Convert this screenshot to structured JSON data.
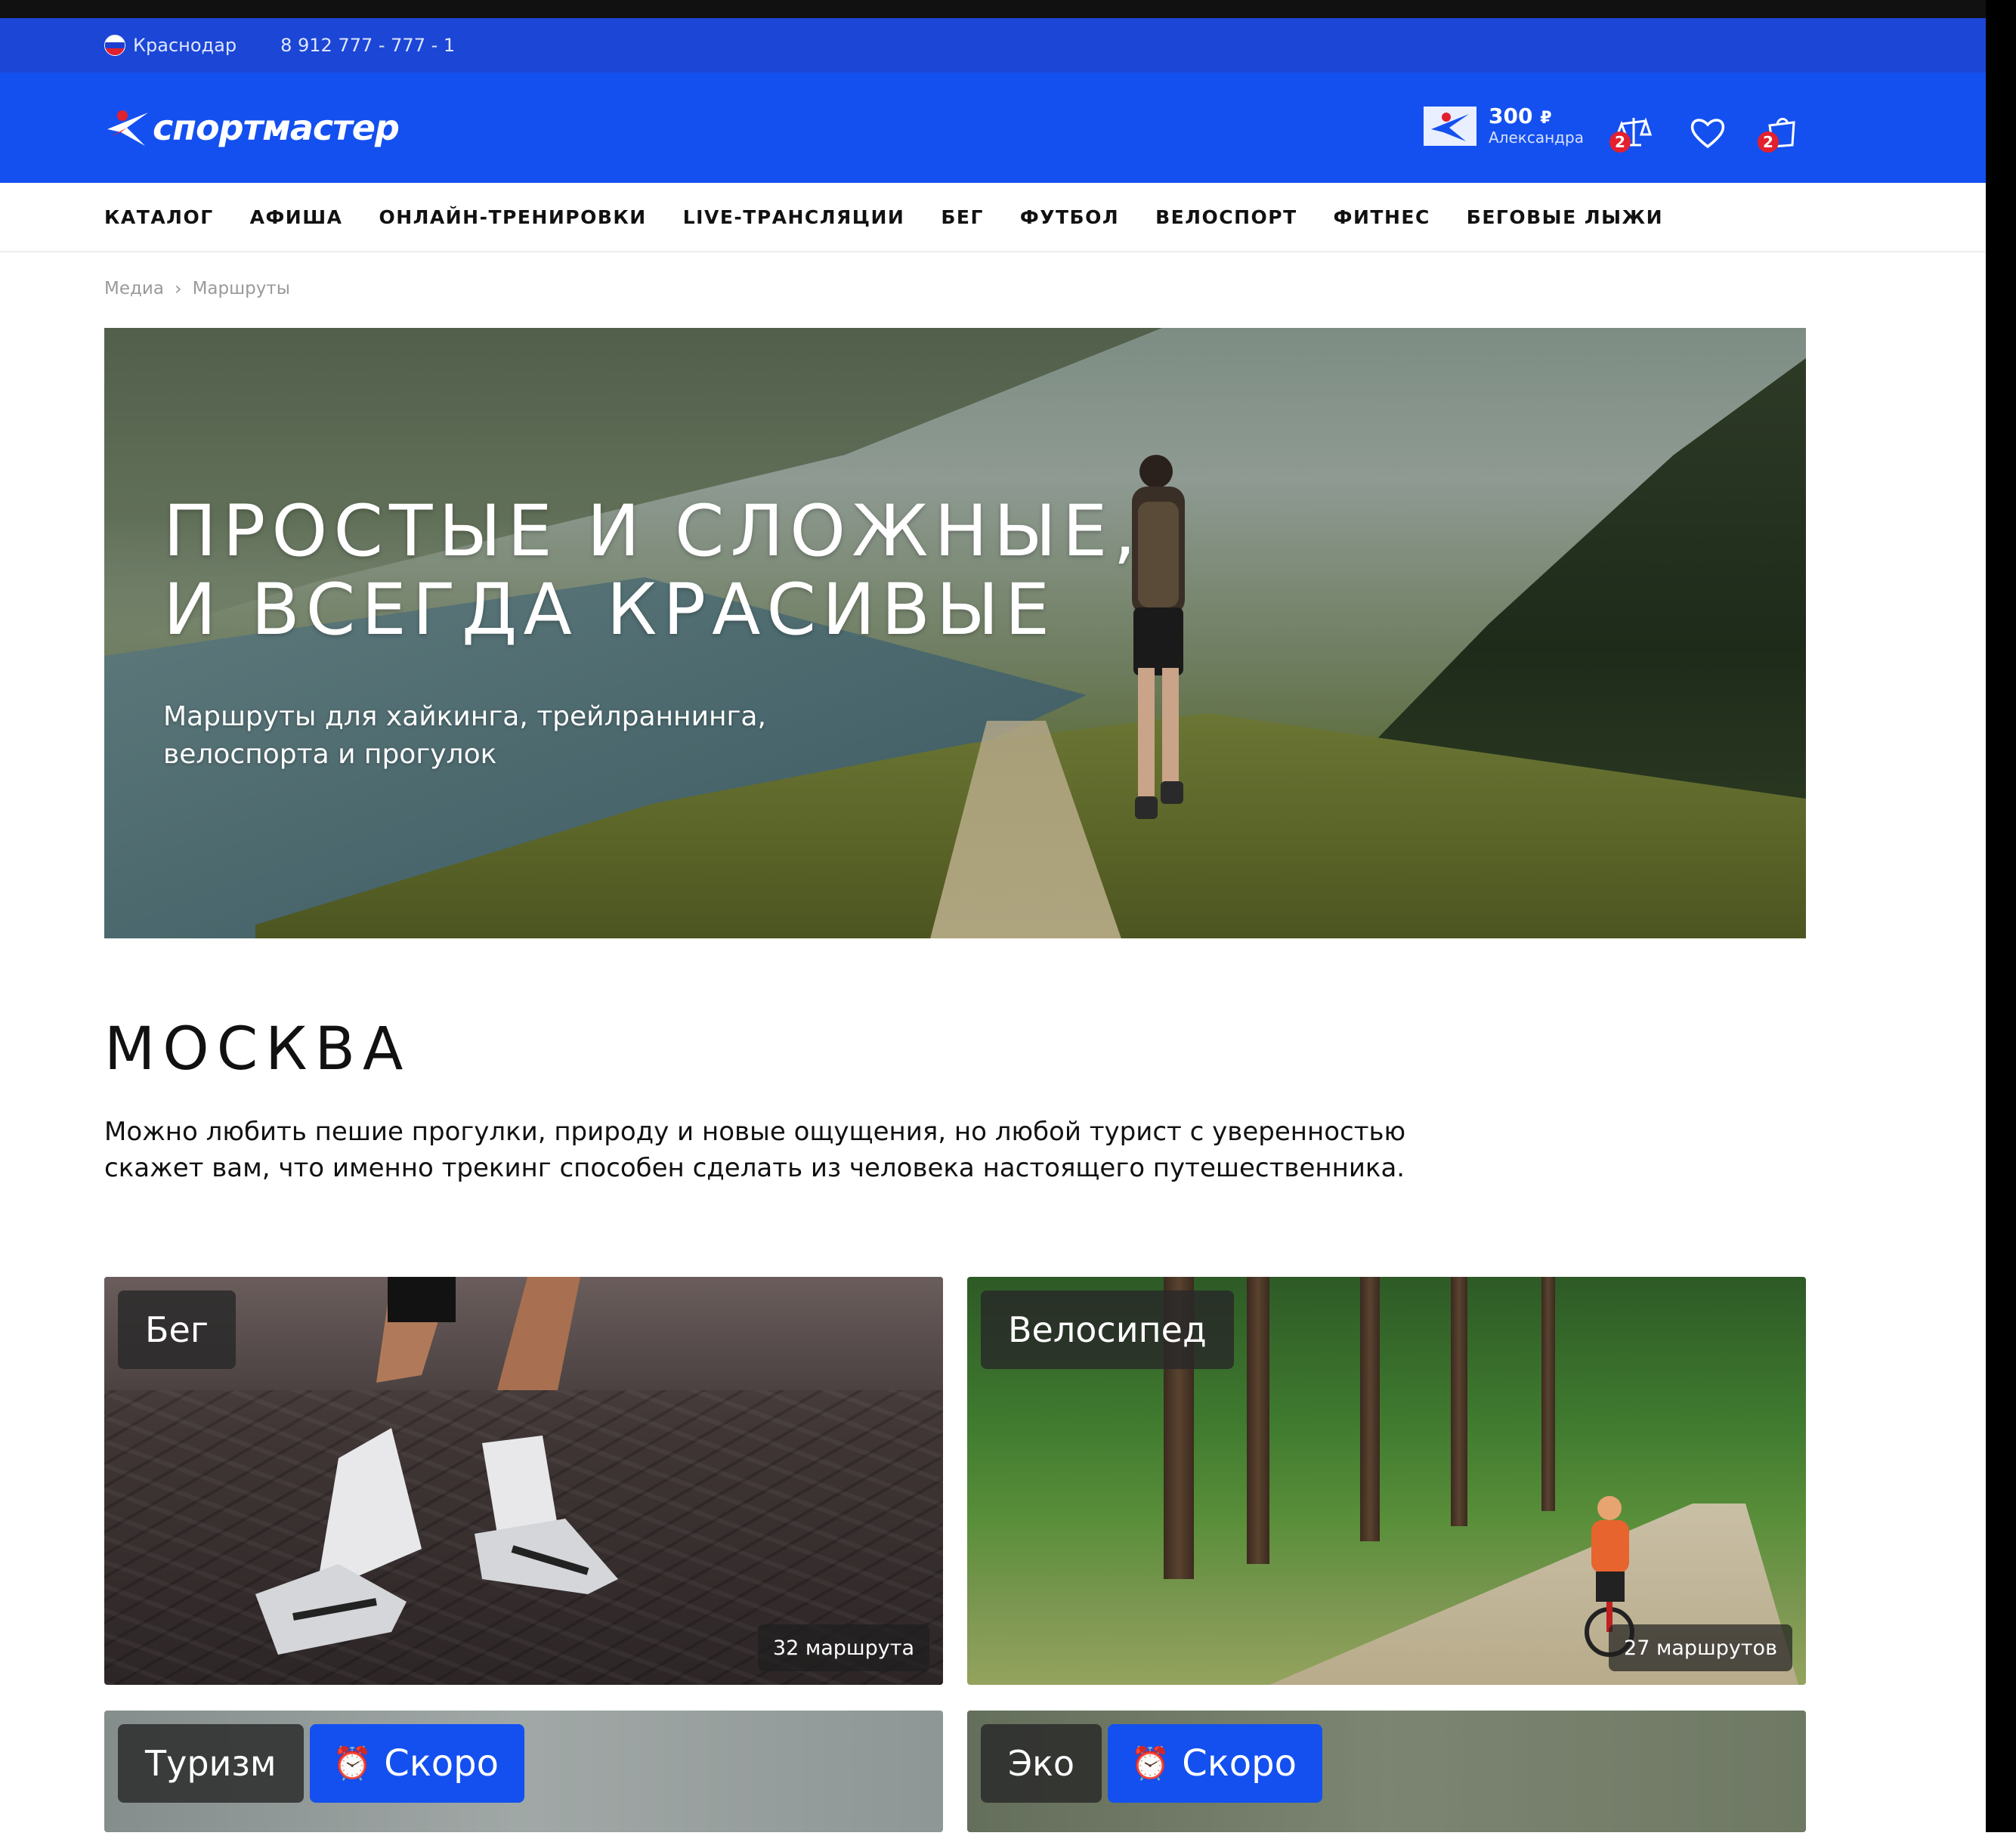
{
  "topbar": {
    "city": "Краснодар",
    "phone": "8 912 777 - 777 - 1"
  },
  "header": {
    "logo_text": "спортмастер",
    "bonus_amount": "300",
    "bonus_currency": "₽",
    "bonus_user": "Александра",
    "compare_badge": "2",
    "cart_badge": "2",
    "brand_color": "#1450f0",
    "badge_color": "#e3202e"
  },
  "nav": {
    "items": [
      "КАТАЛОГ",
      "АФИША",
      "ОНЛАЙН-ТРЕНИРОВКИ",
      "LIVE-ТРАНСЛЯЦИИ",
      "БЕГ",
      "ФУТБОЛ",
      "ВЕЛОСПОРТ",
      "ФИТНЕС",
      "БЕГОВЫЕ ЛЫЖИ"
    ]
  },
  "breadcrumb": {
    "items": [
      "Медиа",
      "Маршруты"
    ]
  },
  "hero": {
    "title_line1": "ПРОСТЫЕ И СЛОЖНЫЕ,",
    "title_line2": "И ВСЕГДА КРАСИВЫЕ",
    "subtitle_line1": "Маршруты для хайкинга, трейлраннинга,",
    "subtitle_line2": "велоспорта и прогулок"
  },
  "section": {
    "title": "МОСКВА",
    "intro": "Можно любить пешие прогулки, природу и новые ощущения, но любой турист с уверенностью скажет вам, что именно трекинг способен сделать из человека настоящего путешественника."
  },
  "cards": [
    {
      "label": "Бег",
      "count": "32 маршрута"
    },
    {
      "label": "Велосипед",
      "count": "27 маршрутов"
    },
    {
      "label": "Туризм",
      "soon": "Скоро"
    },
    {
      "label": "Эко",
      "soon": "Скоро"
    }
  ],
  "icons": {
    "soon_icon": "alarm-clock",
    "compare_icon": "scales-icon",
    "favorites_icon": "heart-icon",
    "cart_icon": "shopping-bag-icon"
  }
}
